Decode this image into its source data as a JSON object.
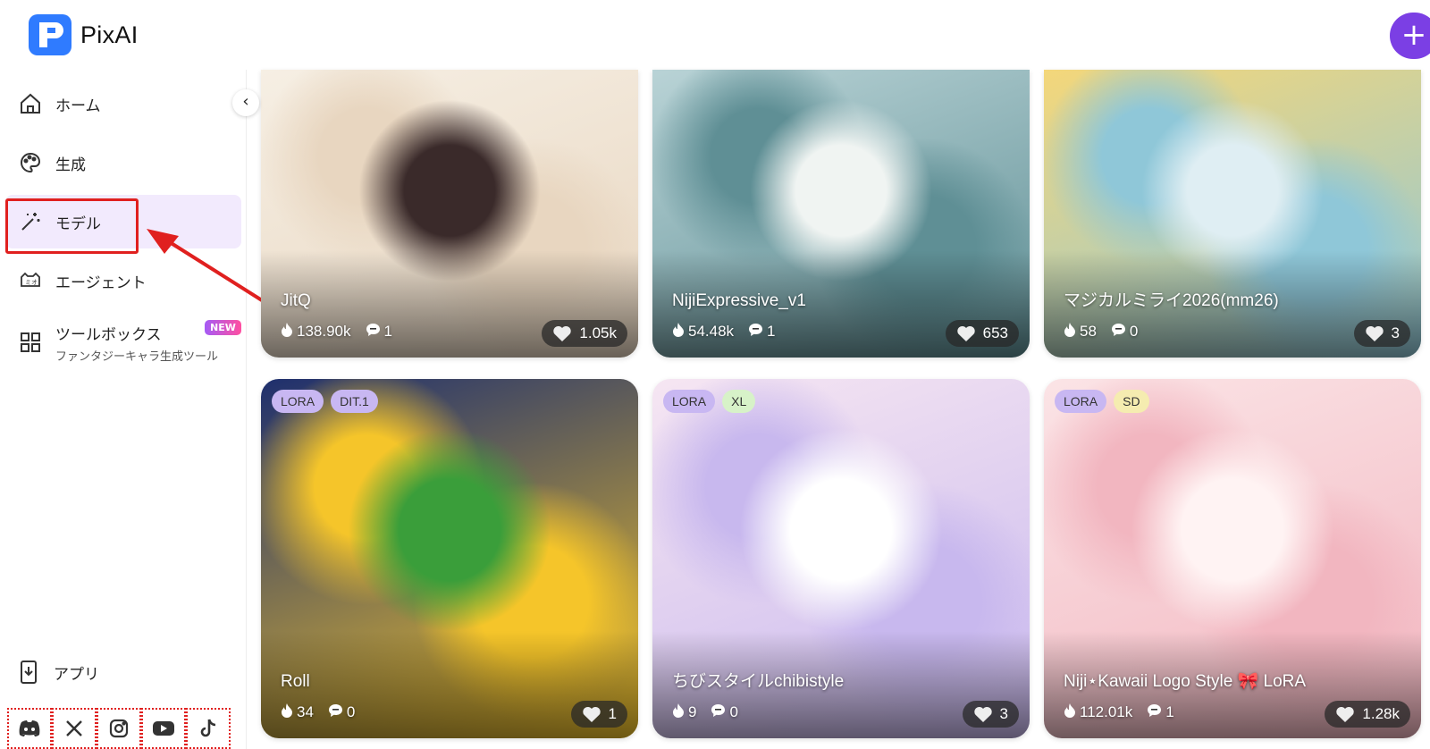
{
  "header": {
    "brand": "PixAI",
    "plus_label": "+"
  },
  "sidebar": {
    "items": [
      {
        "label": "ホーム",
        "icon": "home-icon"
      },
      {
        "label": "生成",
        "icon": "palette-icon"
      },
      {
        "label": "モデル",
        "icon": "magic-wand-icon",
        "active": true
      },
      {
        "label": "エージェント",
        "icon": "agent-icon"
      },
      {
        "label": "ツールボックス",
        "sub": "ファンタジーキャラ生成ツール",
        "badge": "NEW",
        "icon": "grid-icon"
      }
    ],
    "app_label": "アプリ",
    "socials": [
      "discord-icon",
      "x-icon",
      "instagram-icon",
      "youtube-icon",
      "tiktok-icon"
    ],
    "collapse_glyph": "‹"
  },
  "cards": [
    {
      "title": "JitQ",
      "views": "138.90k",
      "comments": "1",
      "likes": "1.05k",
      "tags": [],
      "palette": [
        "#f6efe4",
        "#e8d6c0",
        "#3a2a2a"
      ]
    },
    {
      "title": "NijiExpressive_v1",
      "views": "54.48k",
      "comments": "1",
      "likes": "653",
      "tags": [],
      "palette": [
        "#b9d3d6",
        "#5f8f95",
        "#f0f4f2"
      ]
    },
    {
      "title": "マジカルミライ2026(mm26)",
      "views": "58",
      "comments": "0",
      "likes": "3",
      "tags": [],
      "palette": [
        "#f4d77a",
        "#8fc7d8",
        "#dfeef3"
      ]
    },
    {
      "title": "Roll",
      "views": "34",
      "comments": "0",
      "likes": "1",
      "tags": [
        "LORA",
        "DIT.1"
      ],
      "palette": [
        "#1e2f6e",
        "#f5c52a",
        "#3a9e3a"
      ]
    },
    {
      "title": "ちびスタイルchibistyle",
      "views": "9",
      "comments": "0",
      "likes": "3",
      "tags": [
        "LORA",
        "XL"
      ],
      "palette": [
        "#f6e6f2",
        "#c8b8ee",
        "#ffffff"
      ]
    },
    {
      "title": "Niji⋆Kawaii Logo Style 🎀 LoRA",
      "views": "112.01k",
      "comments": "1",
      "likes": "1.28k",
      "tags": [
        "LORA",
        "SD"
      ],
      "palette": [
        "#fbe4e6",
        "#f2b6c0",
        "#fff3f3"
      ]
    }
  ],
  "colors": {
    "accent": "#7b3fe4",
    "highlight": "#e0201f",
    "active_bg": "#f2eafd",
    "brand_blue": "#2f7bff"
  }
}
